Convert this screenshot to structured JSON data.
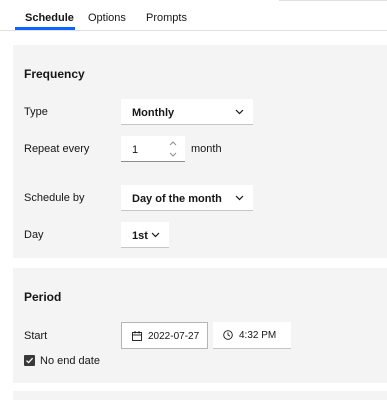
{
  "tabs": [
    {
      "label": "Schedule",
      "active": true
    },
    {
      "label": "Options",
      "active": false
    },
    {
      "label": "Prompts",
      "active": false
    }
  ],
  "frequency": {
    "title": "Frequency",
    "type_label": "Type",
    "type_value": "Monthly",
    "repeat_label": "Repeat every",
    "repeat_value": "1",
    "repeat_unit": "month",
    "schedule_by_label": "Schedule by",
    "schedule_by_value": "Day of the month",
    "day_label": "Day",
    "day_value": "1st"
  },
  "period": {
    "title": "Period",
    "start_label": "Start",
    "start_date": "2022-07-27",
    "start_time": "4:32 PM",
    "no_end_label": "No end date",
    "no_end_checked": true
  },
  "colors": {
    "accent": "#0f62fe",
    "panel_bg": "#f4f4f4",
    "field_bg": "#ffffff",
    "checkbox": "#393939"
  }
}
